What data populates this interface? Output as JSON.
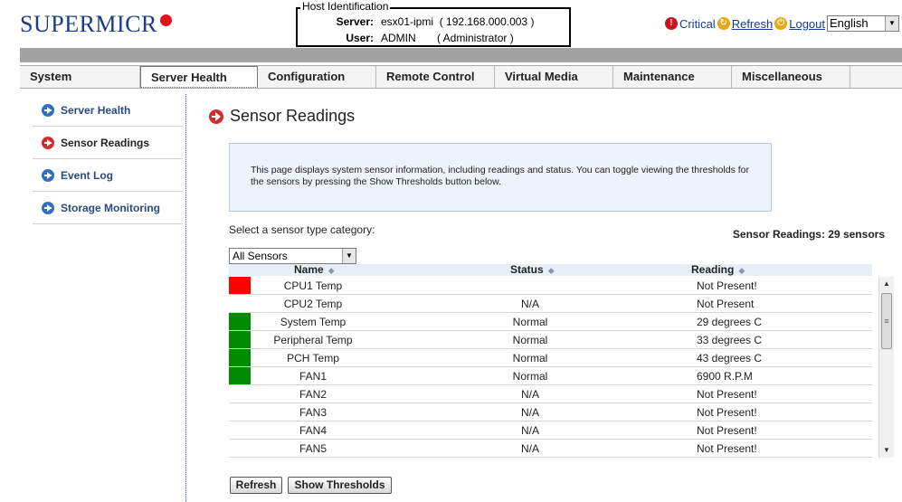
{
  "header": {
    "logo_text": "SUPERMICR",
    "host_identification": {
      "legend": "Host Identification",
      "server_label": "Server:",
      "server_value": "esx01-ipmi  ( 192.168.000.003 )",
      "user_label": "User:",
      "user_value": "ADMIN       ( Administrator )"
    },
    "status": {
      "critical": "Critical",
      "refresh": "Refresh",
      "logout": "Logout"
    },
    "language": "English"
  },
  "nav": {
    "tabs": [
      "System",
      "Server Health",
      "Configuration",
      "Remote Control",
      "Virtual Media",
      "Maintenance",
      "Miscellaneous"
    ]
  },
  "sidebar": {
    "items": [
      "Server Health",
      "Sensor Readings",
      "Event Log",
      "Storage Monitoring"
    ]
  },
  "main": {
    "title": "Sensor Readings",
    "info": "This page displays system sensor information, including readings and status. You can toggle viewing the thresholds for the sensors by pressing the Show Thresholds button below.",
    "select_label": "Select a sensor type category:",
    "sensor_count": "Sensor Readings: 29 sensors",
    "category": "All Sensors",
    "columns": {
      "name": "Name",
      "status": "Status",
      "reading": "Reading"
    },
    "rows": [
      {
        "name": "CPU1 Temp",
        "status": "",
        "reading": "Not Present!",
        "indicator": "#ff0000"
      },
      {
        "name": "CPU2 Temp",
        "status": "N/A",
        "reading": "Not Present",
        "indicator": ""
      },
      {
        "name": "System Temp",
        "status": "Normal",
        "reading": "29 degrees C",
        "indicator": "#008a00"
      },
      {
        "name": "Peripheral Temp",
        "status": "Normal",
        "reading": "33 degrees C",
        "indicator": "#008a00"
      },
      {
        "name": "PCH Temp",
        "status": "Normal",
        "reading": "43 degrees C",
        "indicator": "#008a00"
      },
      {
        "name": "FAN1",
        "status": "Normal",
        "reading": "6900 R.P.M",
        "indicator": "#008a00"
      },
      {
        "name": "FAN2",
        "status": "N/A",
        "reading": "Not Present!",
        "indicator": ""
      },
      {
        "name": "FAN3",
        "status": "N/A",
        "reading": "Not Present!",
        "indicator": ""
      },
      {
        "name": "FAN4",
        "status": "N/A",
        "reading": "Not Present!",
        "indicator": ""
      },
      {
        "name": "FAN5",
        "status": "N/A",
        "reading": "Not Present!",
        "indicator": ""
      }
    ],
    "buttons": {
      "refresh": "Refresh",
      "show_thresholds": "Show Thresholds"
    }
  },
  "icons": {
    "critical": "critical-icon",
    "refresh": "refresh-icon",
    "logout": "logout-icon",
    "nav_arrow": "arrow-right-icon",
    "dropdown": "chevron-down-icon",
    "sort": "sort-icon"
  },
  "colors": {
    "brand": "#1b3b8c",
    "accent_red": "#e0141e",
    "normal": "#008a00",
    "critical": "#ff0000"
  }
}
